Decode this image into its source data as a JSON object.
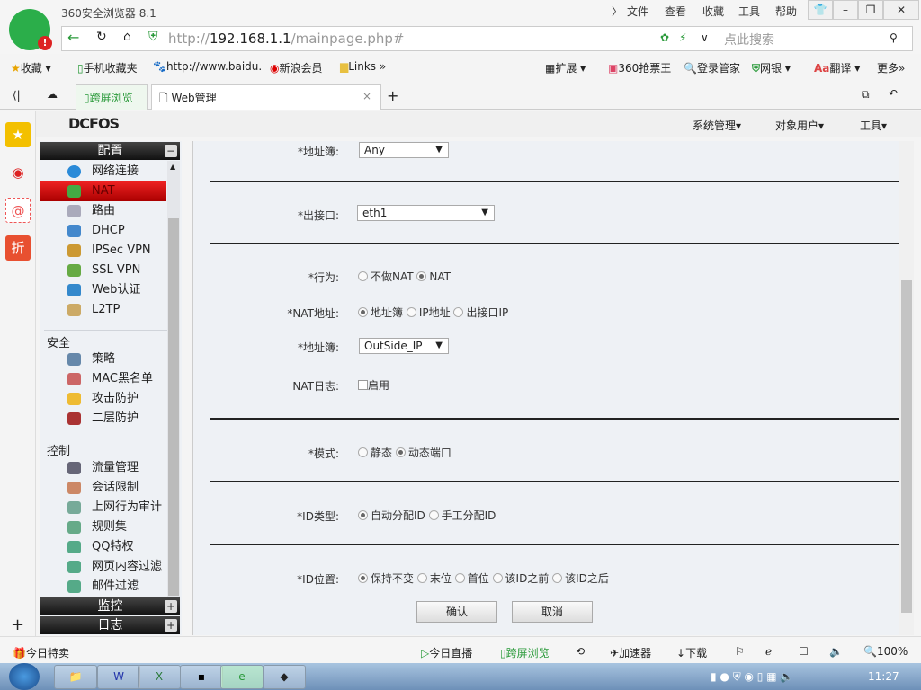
{
  "browser": {
    "title": "360安全浏览器 8.1",
    "menus": [
      "文件",
      "查看",
      "收藏",
      "工具",
      "帮助"
    ],
    "url_prefix": "http://",
    "url_host": "192.168.1.1",
    "url_path": "/mainpage.php#",
    "search_placeholder": "点此搜索",
    "bookmarks": [
      "收藏",
      "手机收藏夹",
      "http://www.baidu.",
      "新浪会员",
      "Links"
    ],
    "bookmarks_right": [
      "扩展",
      "360抢票王",
      "登录管家",
      "网银",
      "翻译",
      "更多"
    ],
    "tabs": [
      "跨屏浏览",
      "Web管理"
    ]
  },
  "app": {
    "logo": "DCFOS",
    "top_menu": [
      "系统管理▾",
      "对象用户▾",
      "工具▾"
    ]
  },
  "sidebar": {
    "config_header": "配置",
    "config_items": [
      "网络连接",
      "NAT",
      "路由",
      "DHCP",
      "IPSec VPN",
      "SSL VPN",
      "Web认证",
      "L2TP"
    ],
    "security_header": "安全",
    "security_items": [
      "策略",
      "MAC黑名单",
      "攻击防护",
      "二层防护"
    ],
    "control_header": "控制",
    "control_items": [
      "流量管理",
      "会话限制",
      "上网行为审计",
      "规则集",
      "QQ特权",
      "网页内容过滤",
      "邮件过滤"
    ],
    "monitor_header": "监控",
    "log_header": "日志"
  },
  "form": {
    "addrbook1": {
      "label": "*地址簿:",
      "value": "Any"
    },
    "out_if": {
      "label": "*出接口:",
      "value": "eth1"
    },
    "action": {
      "label": "*行为:",
      "options": [
        "不做NAT",
        "NAT"
      ],
      "selected": 1
    },
    "nat_addr": {
      "label": "*NAT地址:",
      "options": [
        "地址簿",
        "IP地址",
        "出接口IP"
      ],
      "selected": 0
    },
    "addrbook2": {
      "label": "*地址簿:",
      "value": "OutSide_IP"
    },
    "nat_log": {
      "label": "NAT日志:",
      "option": "启用",
      "checked": false
    },
    "mode": {
      "label": "*模式:",
      "options": [
        "静态",
        "动态端口"
      ],
      "selected": 1
    },
    "id_type": {
      "label": "*ID类型:",
      "options": [
        "自动分配ID",
        "手工分配ID"
      ],
      "selected": 0
    },
    "id_pos": {
      "label": "*ID位置:",
      "options": [
        "保持不变",
        "末位",
        "首位",
        "该ID之前",
        "该ID之后"
      ],
      "selected": 0
    },
    "confirm": "确认",
    "cancel": "取消"
  },
  "status": {
    "left": "今日特卖",
    "live": "今日直播",
    "cross": "跨屏浏览",
    "accel": "加速器",
    "download": "下载",
    "zoom": "100%"
  },
  "taskbar": {
    "time": "11:27"
  }
}
